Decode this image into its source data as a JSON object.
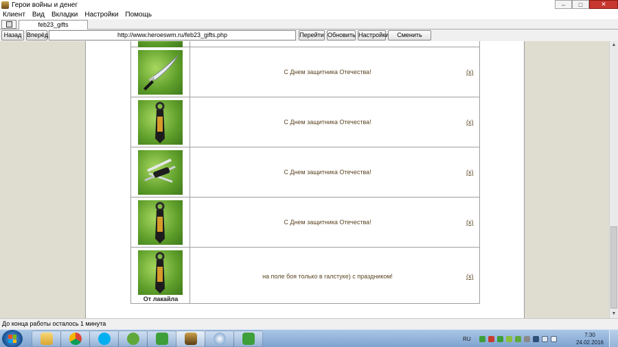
{
  "window": {
    "title": "Герои войны и денег",
    "controls": [
      "–",
      "□",
      "✕"
    ]
  },
  "menu": [
    "Клиент",
    "Вид",
    "Вкладки",
    "Настройки",
    "Помощь"
  ],
  "tabs": [
    {
      "label": "feb23_gifts",
      "active": true
    }
  ],
  "nav": {
    "back": "Назад",
    "forward": "Вперёд",
    "url": "http://www.heroeswm.ru/feb23_gifts.php",
    "go": "Перейти",
    "refresh": "Обновить",
    "settings": "Настройки",
    "switch_player": "Сменить игрока"
  },
  "gifts": [
    {
      "icon": "knife-icon",
      "message": "С Днем защитника Отечества!",
      "remove": "(x)"
    },
    {
      "icon": "tie-icon",
      "message": "С Днем защитника Отечества!",
      "remove": "(x)"
    },
    {
      "icon": "multitool-icon",
      "message": "С Днем защитника Отечества!",
      "remove": "(x)"
    },
    {
      "icon": "tie-icon",
      "message": "С Днем защитника Отечества!",
      "remove": "(x)"
    },
    {
      "icon": "tie-icon",
      "message": "на поле боя только в галстуке) с праздником!",
      "remove": "(x)",
      "sender": "От лакайла"
    }
  ],
  "status": "До конца работы осталось 1 минута",
  "taskbar": {
    "apps": [
      "explorer-icon",
      "chrome-icon",
      "skype-icon",
      "utorrent-icon",
      "evernote-icon",
      "heroes-game-icon",
      "app-spiral-icon",
      "evernote-icon"
    ],
    "language": "RU",
    "time": "7:30",
    "date": "24.02.2016"
  },
  "colors": {
    "gift_text": "#5a4321",
    "page_background": "#dfdcd0",
    "gift_background": "#5e9e2a"
  }
}
